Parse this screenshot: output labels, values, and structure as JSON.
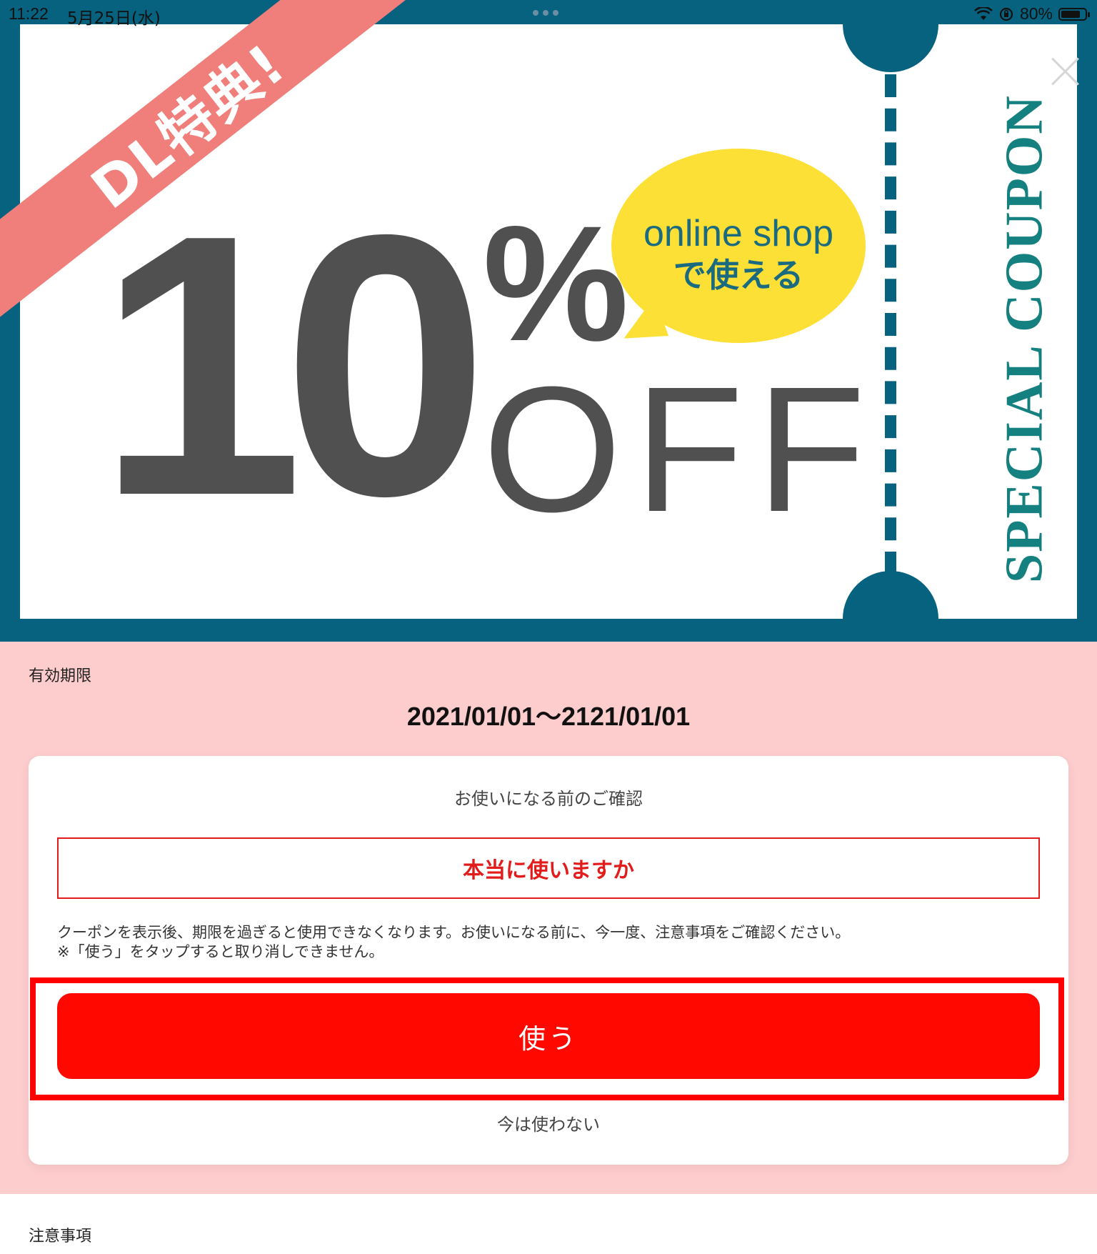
{
  "status_bar": {
    "time": "11:22",
    "date": "5月25日(水)",
    "battery": "80%",
    "battery_level": 0.8
  },
  "coupon": {
    "ribbon_text": "DL特典!",
    "discount_number": "10",
    "percent_sign": "%",
    "off_text": "OFF",
    "bubble_line1": "online shop",
    "bubble_line2": "で使える",
    "side_text": "SPECIAL COUPON",
    "colors": {
      "border": "#07627f",
      "ribbon": "#f07e7b",
      "bubble": "#fde035",
      "side_text": "#14807f"
    }
  },
  "validity": {
    "label": "有効期限",
    "range": "2021/01/01～2121/01/01"
  },
  "confirm_card": {
    "title": "お使いになる前のご確認",
    "question": "本当に使いますか",
    "notice_line1": "クーポンを表示後、期限を過ぎると使用できなくなります。お使いになる前に、今一度、注意事項をご確認ください。",
    "notice_line2": "※「使う」をタップすると取り消しできません。",
    "use_button": "使う",
    "later_link": "今は使わない",
    "colors": {
      "accent_red": "#ff0800",
      "background_pink": "#fdcccd"
    }
  },
  "notes": {
    "label": "注意事項"
  }
}
